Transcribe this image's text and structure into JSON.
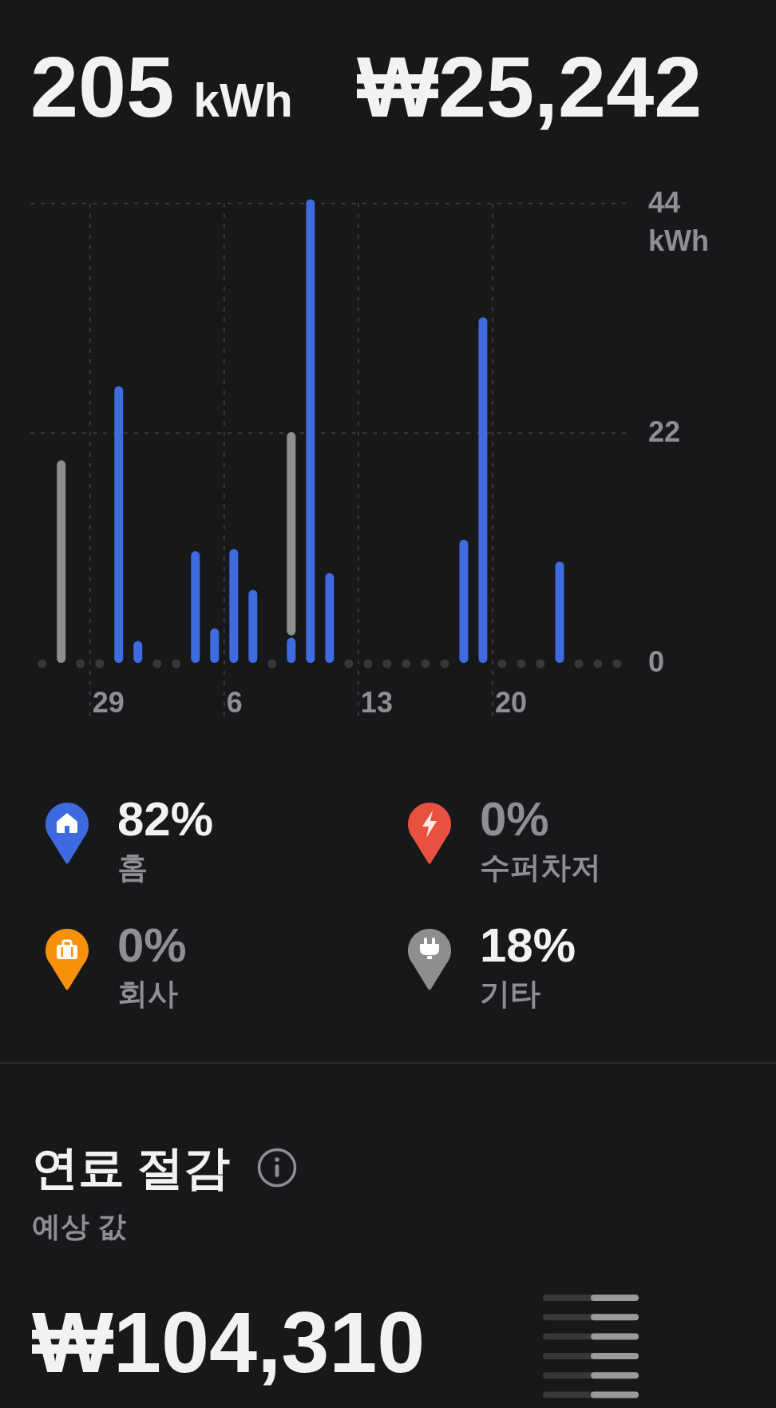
{
  "summary": {
    "energy": {
      "value": "205",
      "unit": "kWh"
    },
    "cost": {
      "value": "₩25,242"
    }
  },
  "chart": {
    "chart_data": {
      "type": "bar",
      "stacked": true,
      "grid": true,
      "ylabel": "kWh",
      "ylim": [
        0,
        44.4
      ],
      "yticks": [
        0,
        22,
        44
      ],
      "categories": [
        null,
        null,
        null,
        "29",
        null,
        null,
        null,
        null,
        null,
        null,
        "6",
        null,
        null,
        null,
        null,
        null,
        null,
        "13",
        null,
        null,
        null,
        null,
        null,
        null,
        "20",
        null,
        null,
        null,
        null,
        null,
        null
      ],
      "series": [
        {
          "color": "#3f6ae0",
          "values": [
            0,
            0,
            0,
            0,
            26.5,
            2.1,
            0,
            0,
            10.7,
            3.3,
            10.9,
            7.0,
            0,
            2.4,
            44.4,
            8.6,
            0,
            0,
            0,
            0,
            0,
            0,
            11.8,
            33.1,
            0,
            0,
            0,
            9.7,
            0,
            0,
            0
          ]
        },
        {
          "color": "#8e8e8e",
          "values": [
            0,
            19.4,
            0,
            0,
            0,
            0,
            0,
            0,
            0,
            0,
            0,
            0,
            0,
            19.7,
            0,
            0,
            0,
            0,
            0,
            0,
            0,
            0,
            0,
            0,
            0,
            0,
            0,
            0,
            0,
            0,
            0
          ]
        }
      ]
    }
  },
  "locations": [
    {
      "kind": "home",
      "percent": "82%",
      "label": "홈",
      "color": "#3e6ae0",
      "muted": false
    },
    {
      "kind": "supercharger",
      "percent": "0%",
      "label": "수퍼차저",
      "color": "#e8513f",
      "muted": true
    },
    {
      "kind": "work",
      "percent": "0%",
      "label": "회사",
      "color": "#f7900a",
      "muted": true
    },
    {
      "kind": "other",
      "percent": "18%",
      "label": "기타",
      "color": "#8e8e8e",
      "muted": false
    }
  ],
  "fuel_savings": {
    "title": "연료 절감",
    "subtitle": "예상 값",
    "amount": "₩104,310"
  }
}
